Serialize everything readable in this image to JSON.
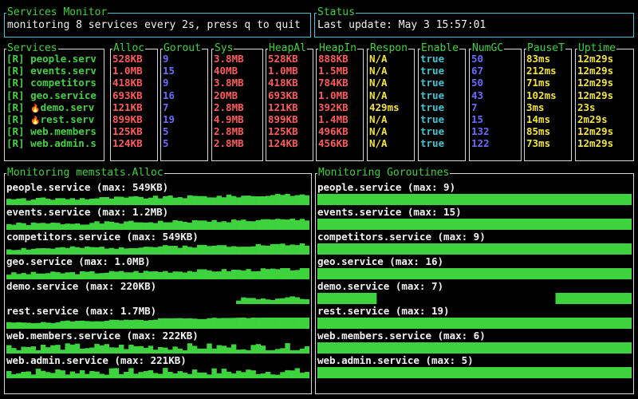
{
  "header": {
    "title": "Services Monitor",
    "subtitle": "monitoring 8 services every 2s, press q to quit"
  },
  "status": {
    "title": "Status",
    "text": "Last update: May  3 15:57:01"
  },
  "colors": {
    "green": "#3ed23e",
    "red": "#ff5a5a",
    "blue": "#6a6aff",
    "yellow": "#f2e33a",
    "cyan": "#3fc4d0",
    "gray": "#cccccc",
    "white": "#ffffff"
  },
  "table": {
    "columns": [
      {
        "key": "services",
        "title": "Services",
        "color": "green"
      },
      {
        "key": "alloc",
        "title": "Alloc",
        "color": "red"
      },
      {
        "key": "goroutines",
        "title": "Gorout",
        "color": "blue"
      },
      {
        "key": "sys",
        "title": "Sys",
        "color": "red"
      },
      {
        "key": "heapalloc",
        "title": "HeapAl",
        "color": "red"
      },
      {
        "key": "heapinuse",
        "title": "HeapIn",
        "color": "red"
      },
      {
        "key": "response",
        "title": "Respon",
        "color": "yellow"
      },
      {
        "key": "enabled",
        "title": "Enable",
        "color": "cyan"
      },
      {
        "key": "numgc",
        "title": "NumGC",
        "color": "blue"
      },
      {
        "key": "pause",
        "title": "PauseT",
        "color": "yellow"
      },
      {
        "key": "uptime",
        "title": "Uptime",
        "color": "yellow"
      }
    ],
    "rows": [
      {
        "flag": "",
        "services": "[R] people.serv",
        "alloc": "528KB",
        "goroutines": "9",
        "sys": "3.8MB",
        "heapalloc": "528KB",
        "heapinuse": "888KB",
        "response": "N/A",
        "enabled": "true",
        "numgc": "50",
        "pause": "83ms",
        "uptime": "12m29s"
      },
      {
        "flag": "",
        "services": "[R] events.serv",
        "alloc": "1.0MB",
        "goroutines": "15",
        "sys": "40MB",
        "heapalloc": "1.0MB",
        "heapinuse": "1.5MB",
        "response": "N/A",
        "enabled": "true",
        "numgc": "67",
        "pause": "212ms",
        "uptime": "12m29s"
      },
      {
        "flag": "",
        "services": "[R] competitors",
        "alloc": "418KB",
        "goroutines": "9",
        "sys": "3.8MB",
        "heapalloc": "418KB",
        "heapinuse": "784KB",
        "response": "N/A",
        "enabled": "true",
        "numgc": "50",
        "pause": "71ms",
        "uptime": "12m29s"
      },
      {
        "flag": "",
        "services": "[R] geo.service",
        "alloc": "693KB",
        "goroutines": "16",
        "sys": "20MB",
        "heapalloc": "693KB",
        "heapinuse": "1.0MB",
        "response": "N/A",
        "enabled": "true",
        "numgc": "43",
        "pause": "102ms",
        "uptime": "12m29s"
      },
      {
        "flag": "🔥",
        "services": "[R]  demo.serv",
        "alloc": "121KB",
        "goroutines": "7",
        "sys": "2.8MB",
        "heapalloc": "121KB",
        "heapinuse": "392KB",
        "response": "429ms",
        "enabled": "true",
        "numgc": "7",
        "pause": "3ms",
        "uptime": "23s"
      },
      {
        "flag": "🔥",
        "services": "[R]  rest.serv",
        "alloc": "899KB",
        "goroutines": "19",
        "sys": "4.9MB",
        "heapalloc": "899KB",
        "heapinuse": "1.4MB",
        "response": "N/A",
        "enabled": "true",
        "numgc": "15",
        "pause": "14ms",
        "uptime": "2m29s"
      },
      {
        "flag": "",
        "services": "[R] web.members",
        "alloc": "125KB",
        "goroutines": "5",
        "sys": "2.8MB",
        "heapalloc": "125KB",
        "heapinuse": "496KB",
        "response": "N/A",
        "enabled": "true",
        "numgc": "132",
        "pause": "85ms",
        "uptime": "12m29s"
      },
      {
        "flag": "",
        "services": "[R] web.admin.s",
        "alloc": "124KB",
        "goroutines": "5",
        "sys": "2.8MB",
        "heapalloc": "124KB",
        "heapinuse": "456KB",
        "response": "N/A",
        "enabled": "true",
        "numgc": "122",
        "pause": "73ms",
        "uptime": "12m29s"
      }
    ]
  },
  "alloc_panel": {
    "title": "Monitoring memstats.Alloc",
    "items": [
      {
        "label": "people.service (max: 549KB)",
        "pattern": "rising"
      },
      {
        "label": "events.service (max: 1.2MB)",
        "pattern": "rising"
      },
      {
        "label": "competitors.service (max: 549KB)",
        "pattern": "rising"
      },
      {
        "label": "geo.service (max: 1.0MB)",
        "pattern": "rising"
      },
      {
        "label": "demo.service (max: 220KB)",
        "pattern": "tail"
      },
      {
        "label": "rest.service (max: 1.7MB)",
        "pattern": "steps"
      },
      {
        "label": "web.members.service (max: 222KB)",
        "pattern": "noisy"
      },
      {
        "label": "web.admin.service (max: 221KB)",
        "pattern": "noisy"
      }
    ]
  },
  "gor_panel": {
    "title": "Monitoring Goroutines",
    "items": [
      {
        "label": "people.service (max: 9)",
        "pattern": "full"
      },
      {
        "label": "events.service (max: 15)",
        "pattern": "full"
      },
      {
        "label": "competitors.service (max: 9)",
        "pattern": "full"
      },
      {
        "label": "geo.service (max: 16)",
        "pattern": "full"
      },
      {
        "label": "demo.service (max: 7)",
        "pattern": "gap"
      },
      {
        "label": "rest.service (max: 19)",
        "pattern": "full"
      },
      {
        "label": "web.members.service (max: 6)",
        "pattern": "full"
      },
      {
        "label": "web.admin.service (max: 5)",
        "pattern": "full"
      }
    ]
  }
}
